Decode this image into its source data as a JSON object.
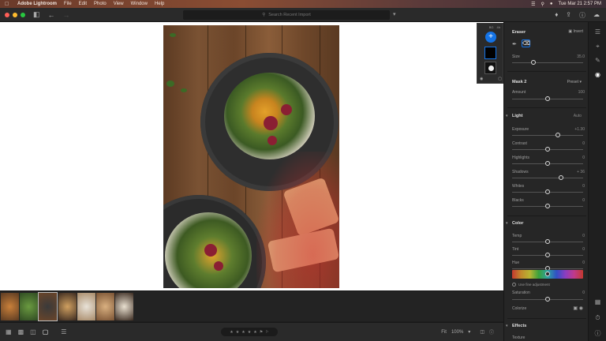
{
  "menubar": {
    "app_name": "Adobe Lightroom",
    "menus": [
      "File",
      "Edit",
      "Photo",
      "View",
      "Window",
      "Help"
    ],
    "datetime": "Tue Mar 21  2:57 PM"
  },
  "titlebar": {
    "search_placeholder": "Search Recent Import"
  },
  "mask_panel": {
    "top_labels": [
      "BG",
      "4h"
    ]
  },
  "right_panel": {
    "eraser_title": "Eraser",
    "invert_label": "Invert",
    "size_label": "Size",
    "size_value": "35.0",
    "mask_name": "Mask 2",
    "preset_label": "Preset",
    "amount_label": "Amount",
    "amount_value": "100",
    "light": {
      "title": "Light",
      "auto_label": "Auto",
      "rows": [
        {
          "label": "Exposure",
          "value": "+1.30",
          "pos": 0.66
        },
        {
          "label": "Contrast",
          "value": "0",
          "pos": 0.5
        },
        {
          "label": "Highlights",
          "value": "0",
          "pos": 0.5
        },
        {
          "label": "Shadows",
          "value": "+ 36",
          "pos": 0.7
        },
        {
          "label": "Whites",
          "value": "0",
          "pos": 0.5
        },
        {
          "label": "Blacks",
          "value": "0",
          "pos": 0.5
        }
      ]
    },
    "color": {
      "title": "Color",
      "rows": [
        {
          "label": "Temp",
          "value": "0",
          "pos": 0.5
        },
        {
          "label": "Tint",
          "value": "0",
          "pos": 0.5
        },
        {
          "label": "Hue",
          "value": "0",
          "pos": 0.5
        }
      ],
      "fine_adjust_label": "Use fine adjustment",
      "saturation_label": "Saturation",
      "saturation_value": "0",
      "colorize_label": "Colorize"
    },
    "effects_title": "Effects",
    "texture_label": "Texture"
  },
  "bottom_bar": {
    "fit_label": "Fit",
    "zoom_label": "100%"
  },
  "colors": {
    "accent": "#1473e6",
    "mask_overlay": "#d63030"
  }
}
